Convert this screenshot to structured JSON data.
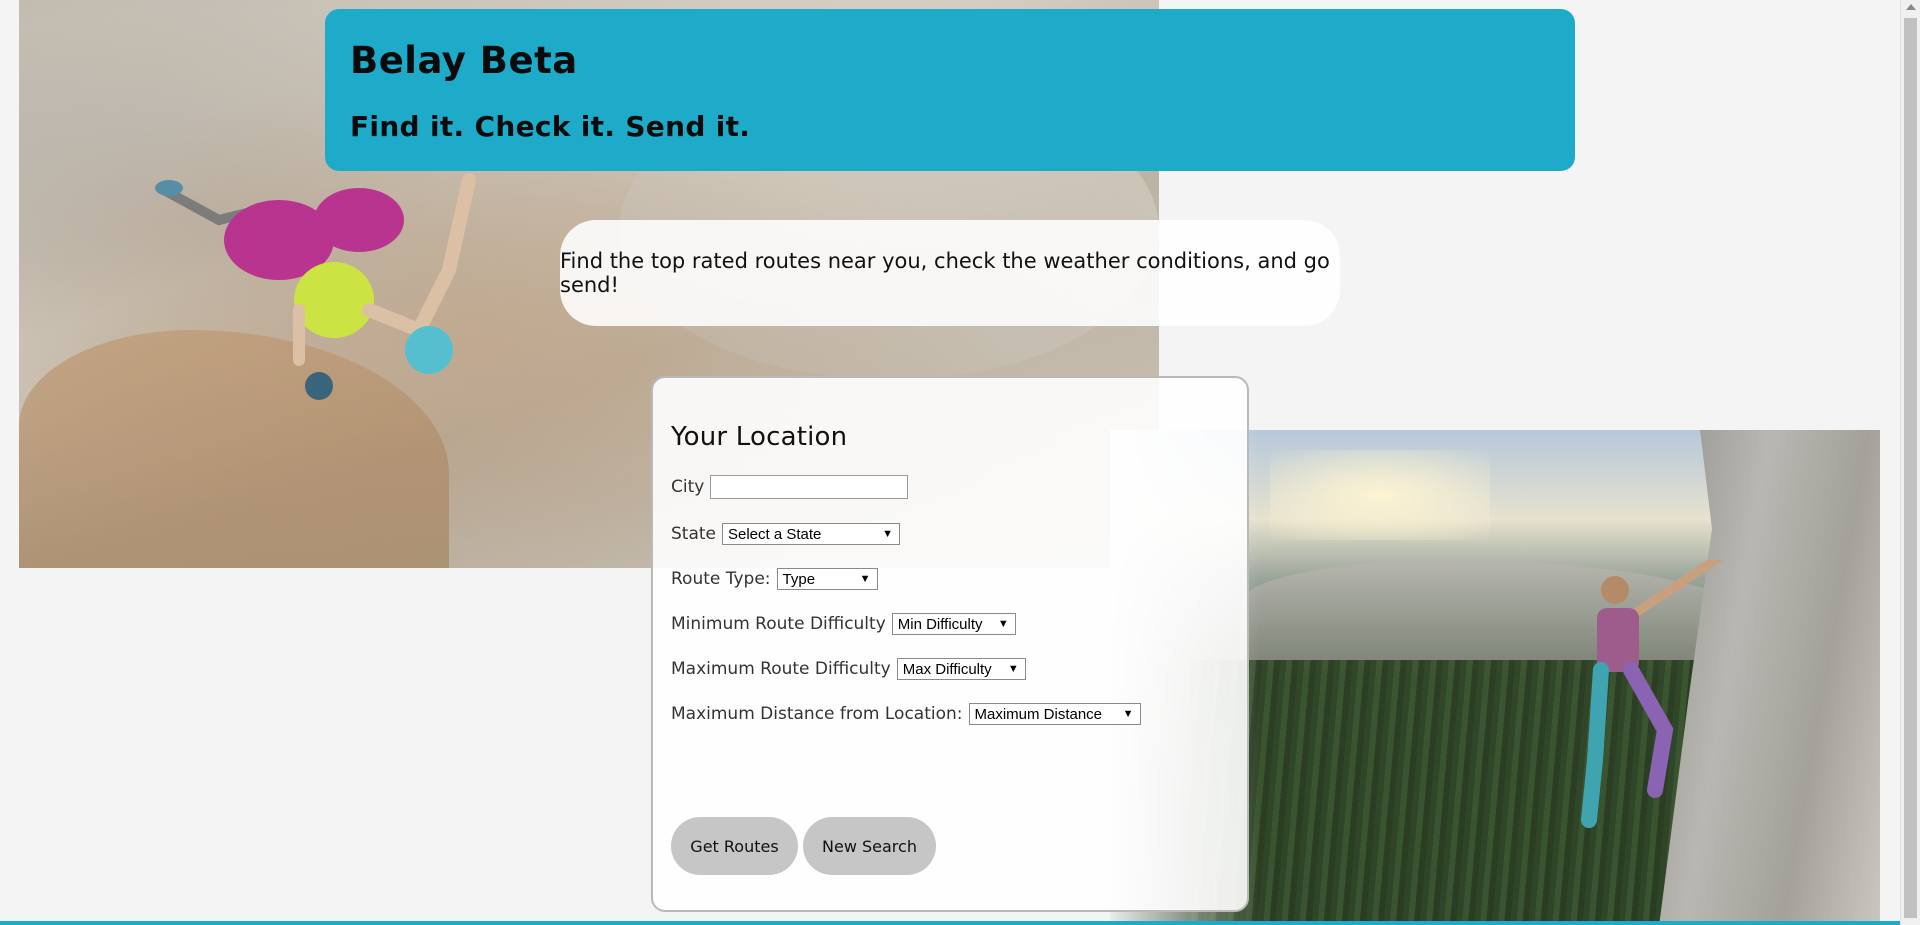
{
  "header": {
    "title": "Belay Beta",
    "tagline": "Find it. Check it. Send it."
  },
  "intro": {
    "text": "Find the top rated routes near you, check the weather conditions, and go send!"
  },
  "form": {
    "heading": "Your Location",
    "city_label": "City",
    "city_value": "",
    "state_label": "State",
    "state_selected": "Select a State",
    "route_type_label": "Route Type:",
    "route_type_selected": "Type",
    "min_difficulty_label": "Minimum Route Difficulty",
    "min_difficulty_selected": "Min Difficulty",
    "max_difficulty_label": "Maximum Route Difficulty",
    "max_difficulty_selected": "Max Difficulty",
    "max_distance_label": "Maximum Distance from Location:",
    "max_distance_selected": "Maximum Distance",
    "get_routes_label": "Get Routes",
    "new_search_label": "New Search"
  },
  "colors": {
    "brand": "#1eabca",
    "button": "#c6c6c6",
    "page_bg": "#f4f4f4"
  },
  "images": {
    "left_photo": "climber-overhang-photo",
    "right_photo": "climber-yosemite-wall-photo"
  }
}
